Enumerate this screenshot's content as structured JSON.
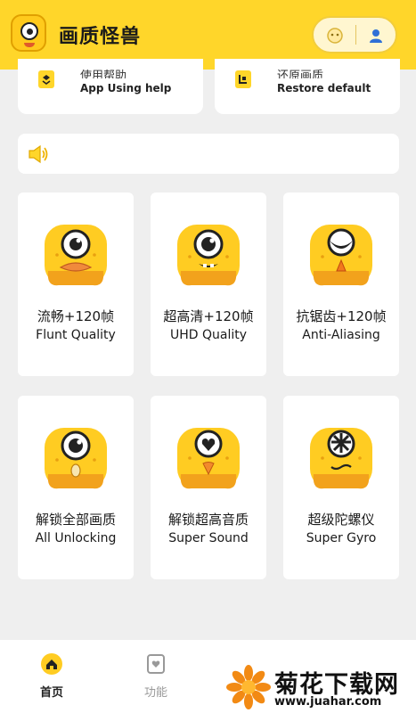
{
  "header": {
    "title": "画质怪兽",
    "logo_icon": "monster-logo-icon",
    "pill": {
      "left_icon": "face-icon",
      "right_icon": "person-icon"
    }
  },
  "top_cards": [
    {
      "title_cn": "使用帮助",
      "title_en": "App Using help",
      "icon": "help-icon"
    },
    {
      "title_cn": "还原画质",
      "title_en": "Restore default",
      "icon": "restore-icon"
    }
  ],
  "notice": {
    "icon": "speaker-icon",
    "text": ""
  },
  "features": [
    {
      "title_cn": "流畅+120帧",
      "title_en": "Flunt Quality",
      "icon": "one-eyed-monster-icon"
    },
    {
      "title_cn": "超高清+120帧",
      "title_en": "UHD Quality",
      "icon": "one-eyed-monster-icon"
    },
    {
      "title_cn": "抗锯齿+120帧",
      "title_en": "Anti-Aliasing",
      "icon": "one-eyed-monster-icon"
    },
    {
      "title_cn": "解锁全部画质",
      "title_en": "All Unlocking",
      "icon": "one-eyed-monster-icon"
    },
    {
      "title_cn": "解锁超高音质",
      "title_en": "Super Sound",
      "icon": "one-eyed-monster-icon"
    },
    {
      "title_cn": "超级陀螺仪",
      "title_en": "Super Gyro",
      "icon": "one-eyed-monster-icon"
    }
  ],
  "tabbar": {
    "tabs": [
      {
        "label": "首页",
        "icon": "home-icon",
        "active": true
      },
      {
        "label": "功能",
        "icon": "features-icon",
        "active": false
      }
    ]
  },
  "watermark": {
    "text": "菊花下载网",
    "url": "www.juahar.com"
  },
  "colors": {
    "brand_yellow": "#ffd62a",
    "mascot_yellow": "#ffcc22",
    "mascot_orange": "#f2a21c",
    "background": "#efefef"
  }
}
